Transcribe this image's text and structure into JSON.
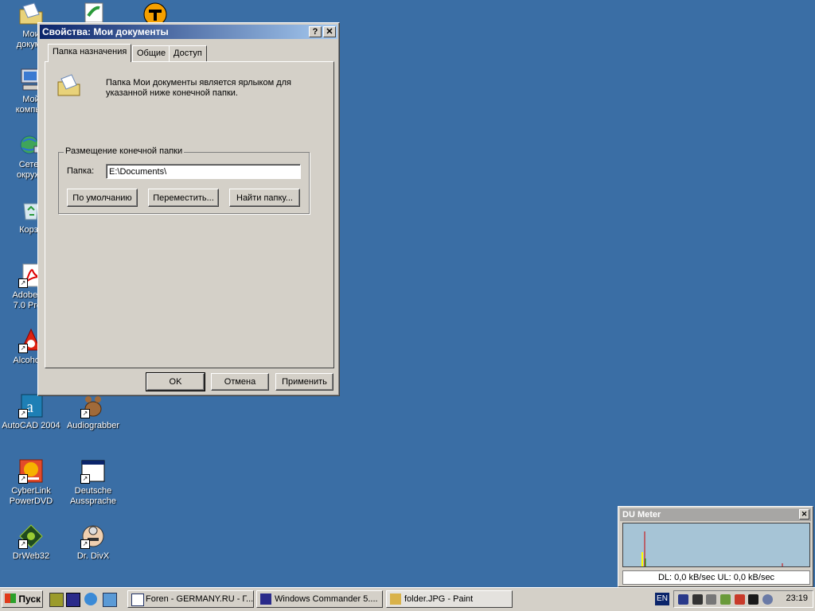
{
  "desktop": {
    "icons": [
      {
        "label": "Мои\nдокуме"
      },
      {
        "label": "Мой\nкомпью"
      },
      {
        "label": "Сетев\nокруже"
      },
      {
        "label": "Корзи"
      },
      {
        "label": "Adobe Ac\n7.0 Profe"
      },
      {
        "label": "Alcohol 1"
      },
      {
        "label": "AutoCAD 2004"
      },
      {
        "label": "Audiograbber"
      },
      {
        "label": "CyberLink\nPowerDVD"
      },
      {
        "label": "Deutsche\nAussprache"
      },
      {
        "label": "DrWeb32"
      },
      {
        "label": "Dr. DivX"
      }
    ]
  },
  "dialog": {
    "title": "Свойства: Мои документы",
    "help_glyph": "?",
    "close_glyph": "✕",
    "tabs": [
      {
        "label": "Папка назначения"
      },
      {
        "label": "Общие"
      },
      {
        "label": "Доступ"
      }
    ],
    "description": "Папка Мои документы является ярлыком для указанной ниже конечной папки.",
    "group_title": "Размещение конечной папки",
    "folder_label": "Папка:",
    "folder_value": "E:\\Documents\\",
    "default_button": "По умолчанию",
    "move_button": "Переместить...",
    "find_button": "Найти папку...",
    "ok_button": "OK",
    "cancel_button": "Отмена",
    "apply_button": "Применить"
  },
  "du_meter": {
    "title": "DU Meter",
    "close_glyph": "✕",
    "status": "DL: 0,0 kB/sec  UL: 0,0 kB/sec"
  },
  "taskbar": {
    "start_label": "Пуск",
    "tasks": [
      {
        "label": "Foren - GERMANY.RU - Г..."
      },
      {
        "label": "Windows Commander 5...."
      },
      {
        "label": "folder.JPG - Paint"
      }
    ],
    "language": "EN",
    "clock": "23:19"
  },
  "colors": {
    "desktop": "#3a6ea5",
    "titlebar_start": "#0a246a",
    "titlebar_end": "#a6caf0",
    "face": "#d4d0c8"
  }
}
